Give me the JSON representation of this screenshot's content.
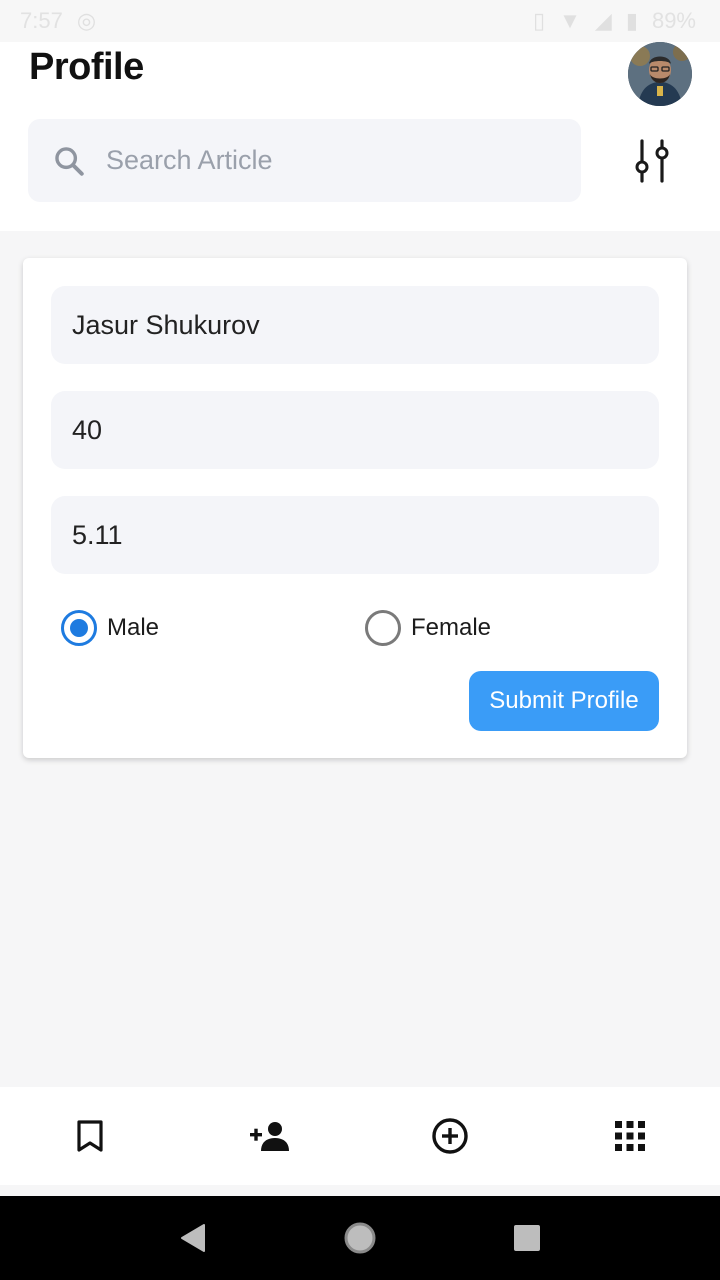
{
  "status_bar": {
    "time": "7:57",
    "battery": "89%"
  },
  "header": {
    "title": "Profile",
    "search": {
      "placeholder": "Search Article",
      "value": ""
    }
  },
  "form": {
    "name_value": "Jasur Shukurov",
    "age_value": "40",
    "height_value": "5.11",
    "gender_options": [
      {
        "label": "Male",
        "selected": true
      },
      {
        "label": "Female",
        "selected": false
      }
    ],
    "submit_label": "Submit Profile"
  },
  "bottom_nav": {
    "items": [
      {
        "icon": "bookmark-icon"
      },
      {
        "icon": "add-person-icon"
      },
      {
        "icon": "add-circle-icon"
      },
      {
        "icon": "apps-grid-icon"
      }
    ]
  },
  "colors": {
    "accent": "#1e7be0",
    "button": "#3a9cf7",
    "field_bg": "#f4f5f9",
    "page_bg": "#f6f6f7"
  }
}
